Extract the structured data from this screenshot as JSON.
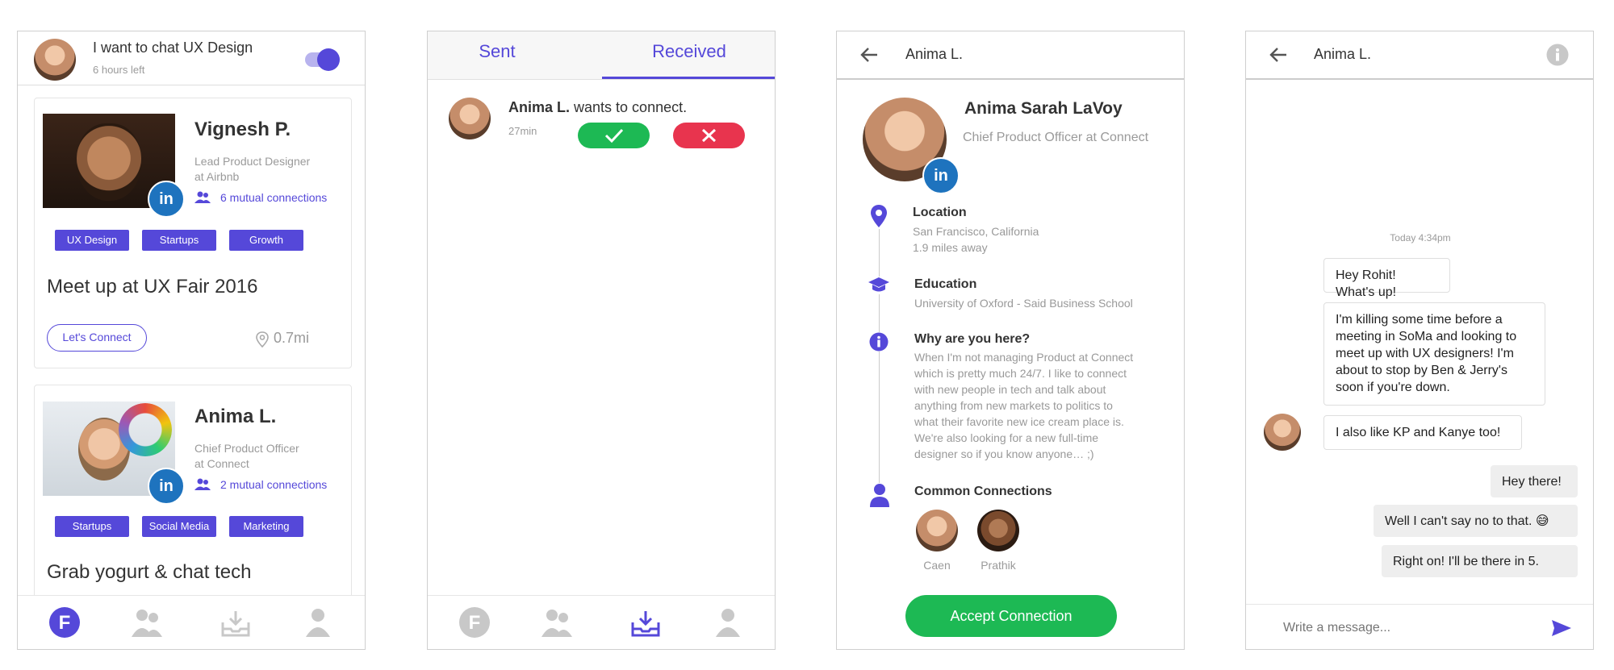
{
  "feed": {
    "status_title": "I want to chat UX Design",
    "status_sub": "6 hours left",
    "cards": [
      {
        "name": "Vignesh P.",
        "role_line1": "Lead Product Designer",
        "role_line2": "at Airbnb",
        "mutual": "6 mutual connections",
        "tags": [
          "UX Design",
          "Startups",
          "Growth"
        ],
        "headline": "Meet up at UX Fair 2016",
        "connect_label": "Let's Connect",
        "distance": "0.7mi"
      },
      {
        "name": "Anima L.",
        "role_line1": "Chief Product Officer",
        "role_line2": "at Connect",
        "mutual": "2 mutual connections",
        "tags": [
          "Startups",
          "Social Media",
          "Marketing"
        ],
        "headline": "Grab yogurt & chat tech"
      }
    ],
    "linkedin_label": "in"
  },
  "requests": {
    "tabs": [
      "Sent",
      "Received"
    ],
    "active_tab": "Received",
    "item": {
      "name": "Anima L.",
      "action": " wants to connect.",
      "time": "27min"
    }
  },
  "profile": {
    "header_name": "Anima L.",
    "full_name": "Anima Sarah LaVoy",
    "title": "Chief Product Officer at Connect",
    "location_title": "Location",
    "location_line1": "San Francisco, California",
    "location_line2": "1.9 miles away",
    "education_title": "Education",
    "education_body": "University of Oxford - Said Business School",
    "why_title": "Why are you here?",
    "why_lines": [
      "When I'm not managing Product at Connect",
      "which is pretty much 24/7. I like to connect",
      "with new people in tech and talk about",
      "anything from new markets to politics to",
      "what their favorite new ice cream place is.",
      "We're also looking for a new full-time",
      "designer so if you know anyone… ;)"
    ],
    "common_title": "Common Connections",
    "connections": [
      "Caen",
      "Prathik"
    ],
    "accept_label": "Accept Connection"
  },
  "chat": {
    "header_name": "Anima L.",
    "timestamp": "Today 4:34pm",
    "messages_them": [
      "Hey Rohit! What's up!",
      "I'm killing some time before a meeting in SoMa and looking to meet up with UX designers! I'm about to stop by Ben & Jerry's soon if you're down.",
      "I also like KP and Kanye too!"
    ],
    "messages_me": [
      "Hey there!",
      "Well I can't say no to that. 😅",
      "Right on! I'll be there in 5."
    ],
    "input_placeholder": "Write a message..."
  },
  "colors": {
    "accent": "#5548d9",
    "green": "#1db954",
    "red": "#e8344e",
    "linkedin": "#1e73be"
  },
  "icons": [
    "avatar",
    "toggle",
    "linkedin-icon",
    "people-icon",
    "pin-icon",
    "home-f-icon",
    "group-icon",
    "inbox-icon",
    "person-icon",
    "check-icon",
    "close-icon",
    "back-arrow-icon",
    "info-icon",
    "graduation-icon",
    "send-icon"
  ]
}
